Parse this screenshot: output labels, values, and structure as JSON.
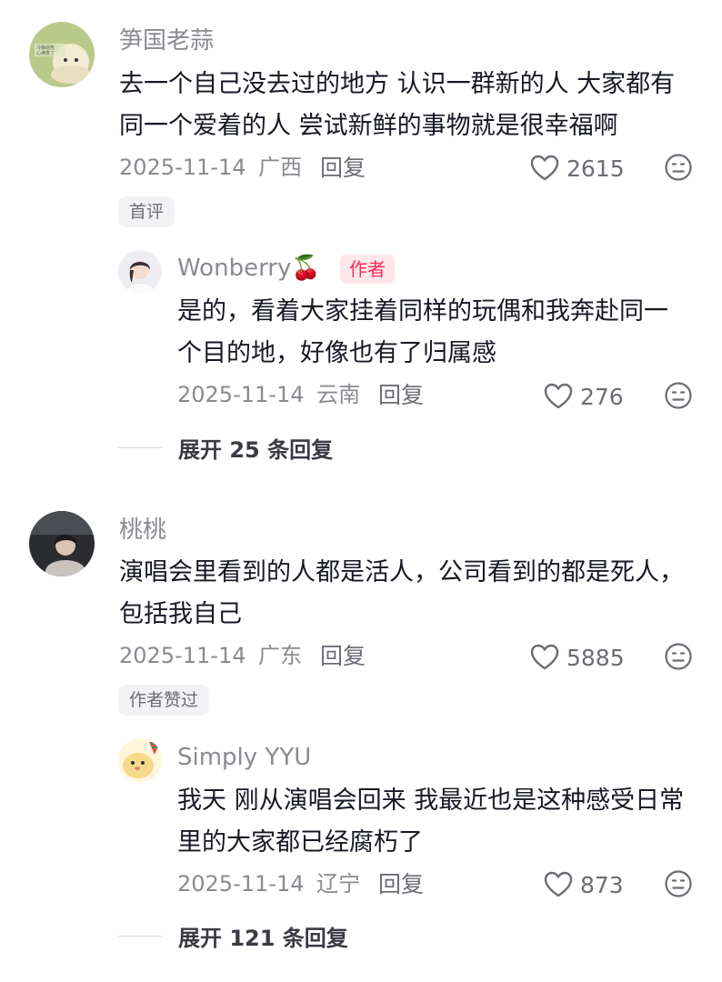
{
  "comments": [
    {
      "username": "笋国老蒜",
      "content": "去一个自己没去过的地方 认识一群新的人 大家都有同一个爱着的人 尝试新鲜的事物就是很幸福啊",
      "date": "2025-11-14",
      "location": "广西",
      "reply_label": "回复",
      "likes": "2615",
      "tag": "首评",
      "avatar_text": "冷静逼死\n心满意了",
      "reply": {
        "username": "Wonberry",
        "emoji": "🍒",
        "author_badge": "作者",
        "content": "是的，看着大家挂着同样的玩偶和我奔赴同一个目的地，好像也有了归属感",
        "date": "2025-11-14",
        "location": "云南",
        "reply_label": "回复",
        "likes": "276"
      },
      "expand_label": "展开 25 条回复"
    },
    {
      "username": "桃桃",
      "content": "演唱会里看到的人都是活人，公司看到的都是死人，包括我自己",
      "date": "2025-11-14",
      "location": "广东",
      "reply_label": "回复",
      "likes": "5885",
      "tag": "作者赞过",
      "reply": {
        "username": "Simply YYU",
        "content": "我天 刚从演唱会回来 我最近也是这种感受日常里的大家都已经腐朽了",
        "date": "2025-11-14",
        "location": "辽宁",
        "reply_label": "回复",
        "likes": "873"
      },
      "expand_label": "展开 121 条回复"
    }
  ],
  "colors": {
    "text": "#161823",
    "secondary": "#8a8b91",
    "accent": "#fe2c55",
    "tag_bg": "#f2f2f4"
  },
  "icons": [
    "heart-icon",
    "dislike-face-icon",
    "cherry-emoji"
  ]
}
